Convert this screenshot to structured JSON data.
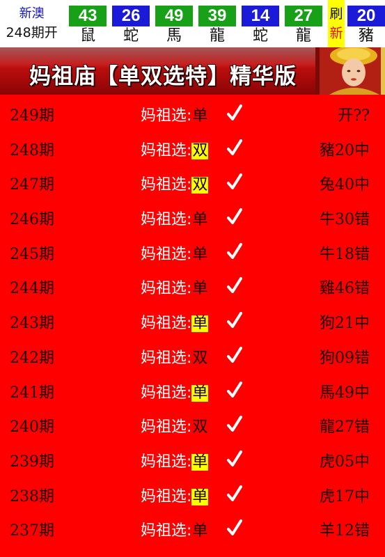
{
  "header": {
    "region": "新澳",
    "period": "248期开",
    "balls": [
      {
        "num": "43",
        "zodiac": "鼠",
        "color": "green"
      },
      {
        "num": "26",
        "zodiac": "蛇",
        "color": "blue"
      },
      {
        "num": "49",
        "zodiac": "馬",
        "color": "green"
      },
      {
        "num": "39",
        "zodiac": "龍",
        "color": "green"
      },
      {
        "num": "14",
        "zodiac": "蛇",
        "color": "blue"
      },
      {
        "num": "27",
        "zodiac": "龍",
        "color": "green"
      }
    ],
    "refresh": [
      "刷",
      "新"
    ],
    "special": {
      "num": "20",
      "zodiac": "豬",
      "color": "blue"
    }
  },
  "banner": {
    "title": "妈祖庙【单双选特】精华版"
  },
  "pick_label": "妈祖选:",
  "rows": [
    {
      "period": "249期",
      "pick": "单",
      "highlight": false,
      "result": "开??"
    },
    {
      "period": "248期",
      "pick": "双",
      "highlight": true,
      "result": "豬20中"
    },
    {
      "period": "247期",
      "pick": "双",
      "highlight": true,
      "result": "兔40中"
    },
    {
      "period": "246期",
      "pick": "单",
      "highlight": false,
      "result": "牛30错"
    },
    {
      "period": "245期",
      "pick": "单",
      "highlight": false,
      "result": "牛18错"
    },
    {
      "period": "244期",
      "pick": "单",
      "highlight": false,
      "result": "雞46错"
    },
    {
      "period": "243期",
      "pick": "单",
      "highlight": true,
      "result": "狗21中"
    },
    {
      "period": "242期",
      "pick": "双",
      "highlight": false,
      "result": "狗09错"
    },
    {
      "period": "241期",
      "pick": "单",
      "highlight": true,
      "result": "馬49中"
    },
    {
      "period": "240期",
      "pick": "双",
      "highlight": false,
      "result": "龍27错"
    },
    {
      "period": "239期",
      "pick": "单",
      "highlight": true,
      "result": "虎05中"
    },
    {
      "period": "238期",
      "pick": "单",
      "highlight": true,
      "result": "虎17中"
    },
    {
      "period": "237期",
      "pick": "单",
      "highlight": false,
      "result": "羊12错"
    }
  ],
  "colors": {
    "green": "#18a018",
    "blue": "#1a1ad8",
    "list_bg": "#ff0000",
    "highlight": "#ffff00"
  }
}
